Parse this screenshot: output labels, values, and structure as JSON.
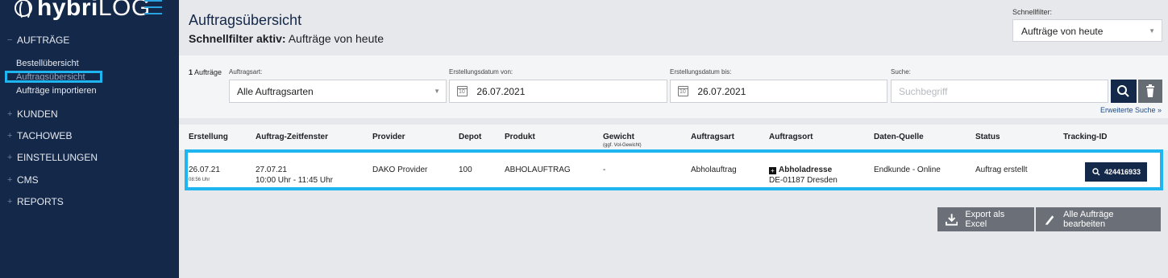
{
  "sidebar": {
    "logo_bold": "hybri",
    "logo_light": "LOG",
    "sections": {
      "auftraege": "AUFTRÄGE",
      "kunden": "KUNDEN",
      "tachoweb": "TACHOWEB",
      "einstellungen": "EINSTELLUNGEN",
      "cms": "CMS",
      "reports": "REPORTS"
    },
    "auftraege_items": [
      "Bestellübersicht",
      "Auftragsübersicht",
      "Aufträge importieren"
    ],
    "expanded_marker": "−",
    "collapsed_marker": "+"
  },
  "header": {
    "title": "Auftragsübersicht",
    "subtitle_bold": "Schnellfilter aktiv:",
    "subtitle_text": "Aufträge von heute",
    "quickfilter_label": "Schnellfilter:",
    "quickfilter_value": "Aufträge von heute"
  },
  "filters": {
    "count_number": "1",
    "count_text": "Aufträge",
    "auftragsart_label": "Auftragsart:",
    "auftragsart_value": "Alle Auftragsarten",
    "von_label": "Erstellungsdatum von:",
    "von_value": "26.07.2021",
    "bis_label": "Erstellungsdatum bis:",
    "bis_value": "26.07.2021",
    "suche_label": "Suche:",
    "suche_placeholder": "Suchbegriff",
    "advanced_link": "Erweiterte Suche »"
  },
  "table": {
    "headers": {
      "erstellung": "Erstellung",
      "zeitfenster": "Auftrag-Zeitfenster",
      "provider": "Provider",
      "depot": "Depot",
      "produkt": "Produkt",
      "gewicht": "Gewicht",
      "gewicht_sub": "(ggf. Vol-Gewicht)",
      "auftragsart": "Auftragsart",
      "auftragsort": "Auftragsort",
      "datenquelle": "Daten-Quelle",
      "status": "Status",
      "tracking": "Tracking-ID"
    },
    "rows": [
      {
        "erstellung_date": "26.07.21",
        "erstellung_time": "08:56 Uhr",
        "zeitfenster_date": "27.07.21",
        "zeitfenster_time": "10:00 Uhr - 11:45 Uhr",
        "provider": "DAKO Provider",
        "depot": "100",
        "produkt": "ABHOLAUFTRAG",
        "gewicht": "-",
        "auftragsart": "Abholauftrag",
        "auftragsort_title": "Abholadresse",
        "auftragsort_address": "DE-01187 Dresden",
        "datenquelle": "Endkunde - Online",
        "status": "Auftrag erstellt",
        "tracking_id": "424416933"
      }
    ]
  },
  "actions": {
    "export": "Export als Excel",
    "edit_all": "Alle Aufträge bearbeiten"
  },
  "colors": {
    "sidebar_bg": "#14284a",
    "highlight": "#1fb5f0",
    "primary_btn": "#14284a",
    "secondary_btn": "#6b7078"
  }
}
